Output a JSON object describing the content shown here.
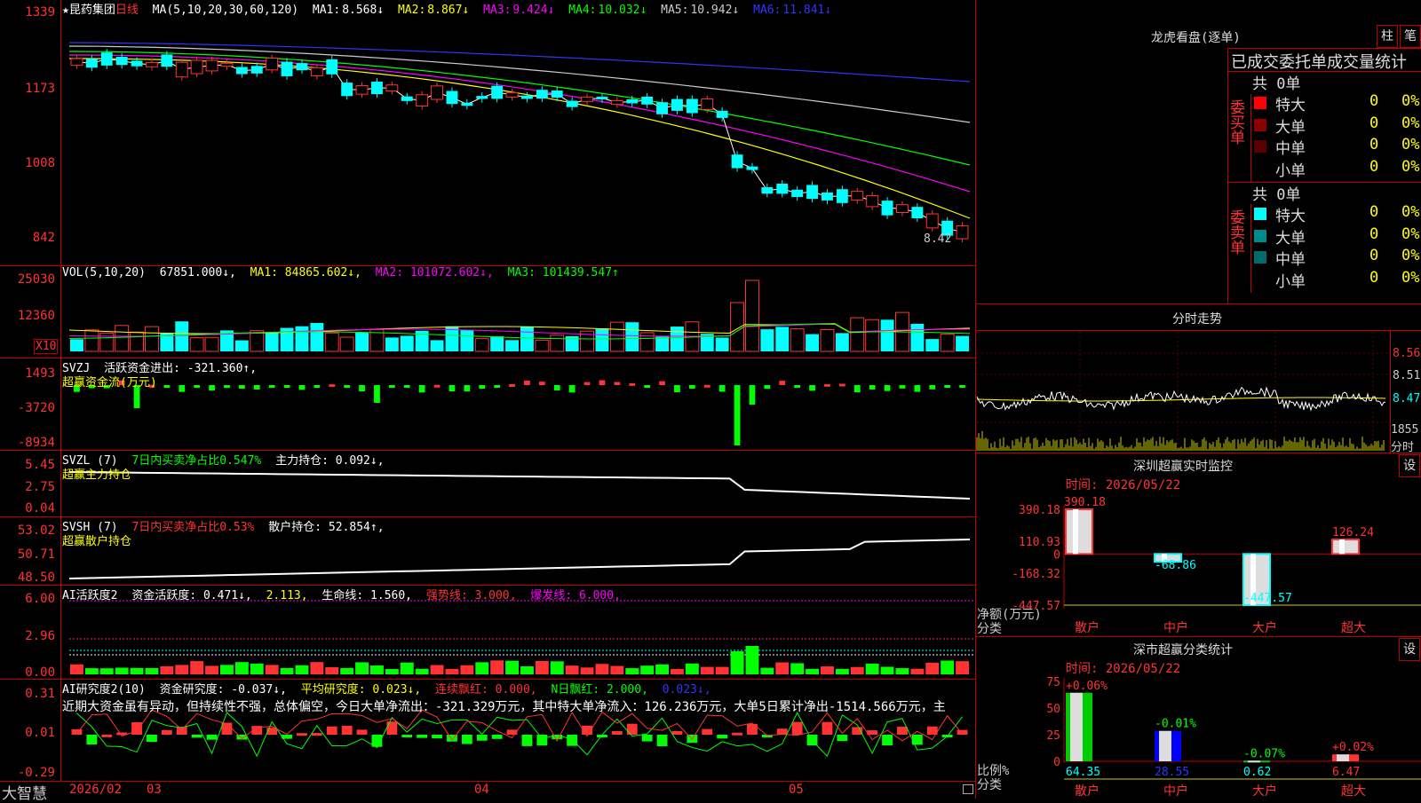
{
  "brand": "大智慧",
  "main": {
    "stock": "★昆药集团",
    "period": "日线",
    "ma_header": {
      "ma": "MA(5,10,20,30,60,120)",
      "items": [
        {
          "label": "MA1:",
          "value": "8.568↓",
          "color": "#ffffff"
        },
        {
          "label": "MA2:",
          "value": "8.867↓",
          "color": "#ffff00"
        },
        {
          "label": "MA3:",
          "value": "9.424↓",
          "color": "#ff00ff"
        },
        {
          "label": "MA4:",
          "value": "10.032↓",
          "color": "#00ff00"
        },
        {
          "label": "MA5:",
          "value": "10.942↓",
          "color": "#cccccc"
        },
        {
          "label": "MA6:",
          "value": "11.841↓",
          "color": "#3333ff"
        }
      ]
    },
    "yticks": [
      "1339",
      "1173",
      "1008",
      "842"
    ],
    "last_price": "8.42"
  },
  "vol": {
    "header": "VOL(5,10,20)",
    "value": "67851.000↓,",
    "ma1": "MA1: 84865.602↓,",
    "ma2": "MA2: 101072.602↓,",
    "ma3": "MA3: 101439.547↑",
    "yticks": [
      "25030",
      "12360"
    ],
    "unit": "X10"
  },
  "svzj": {
    "header": "SVZJ",
    "desc": "活跃资金进出: -321.360↑,",
    "sub": "超赢资金流(万元)",
    "yticks": [
      "1493",
      "-3720",
      "-8934"
    ]
  },
  "svzl": {
    "header": "SVZL (7)",
    "desc": "7日内买卖净占比0.547%",
    "desc2": "主力持仓: 0.092↓,",
    "sub": "超赢主力持仓",
    "yticks": [
      "5.45",
      "2.75",
      "0.04"
    ]
  },
  "svsh": {
    "header": "SVSH (7)",
    "desc": "7日内买卖净占比0.53%",
    "desc2": "散户持仓: 52.854↑,",
    "sub": "超赢散户持仓",
    "yticks": [
      "53.02",
      "50.71",
      "48.50"
    ]
  },
  "ai1": {
    "header": "AI活跃度2",
    "a": "资金活跃度: 0.471↓,",
    "b": "2.113,",
    "c": "生命线: 1.560,",
    "d": "强势线: 3.000,",
    "e": "爆发线: 6.000,",
    "yticks": [
      "6.00",
      "2.96",
      "0.00"
    ]
  },
  "ai2": {
    "header": "AI研究度2(10)",
    "a": "资金研究度: -0.037↓,",
    "b": "平均研究度: 0.023↓,",
    "c": "连续飘红: 0.000,",
    "d": "N日飘红: 2.000,",
    "e": "0.023↓,",
    "text": "近期大资金虽有异动，但持续性不强，总体偏空，今日大单净流出：-321.329万元，其中特大单净流入：126.236万元，大单5日累计净出-1514.566万元，主",
    "yticks": [
      "0.31",
      "0.01",
      "-0.29"
    ]
  },
  "xaxis": [
    "2026/02",
    "03",
    "04",
    "05"
  ],
  "dragon": {
    "title": "龙虎看盘(逐单)",
    "btn1": "柱",
    "btn2": "笔",
    "stat_title": "已成交委托单成交量统计",
    "buy_label": "委买单",
    "sell_label": "委卖单",
    "buy_total": "共 0单",
    "sell_total": "共 0单",
    "buy_rows": [
      {
        "label": "特大",
        "count": "0",
        "pct": "0%",
        "color": "#ff0000"
      },
      {
        "label": "大单",
        "count": "0",
        "pct": "0%",
        "color": "#8b0000"
      },
      {
        "label": "中单",
        "count": "0",
        "pct": "0%",
        "color": "#5a0000"
      },
      {
        "label": "小单",
        "count": "0",
        "pct": "0%",
        "color": "#000000"
      }
    ],
    "sell_rows": [
      {
        "label": "特大",
        "count": "0",
        "pct": "0%",
        "color": "#00ffff"
      },
      {
        "label": "大单",
        "count": "0",
        "pct": "0%",
        "color": "#008b8b"
      },
      {
        "label": "中单",
        "count": "0",
        "pct": "0%",
        "color": "#006b6b"
      },
      {
        "label": "小单",
        "count": "0",
        "pct": "0%",
        "color": "#000000"
      }
    ]
  },
  "intraday": {
    "title": "分时走势",
    "yticks": [
      "8.56",
      "8.51",
      "8.47"
    ],
    "vol_label": "1855",
    "vol_unit": "分时"
  },
  "monitor": {
    "title": "深圳超赢实时监控",
    "set": "设",
    "time": "时间: 2026/05/22",
    "yticks": [
      "390.18",
      "110.93",
      "0",
      "-168.32",
      "-447.57"
    ],
    "ylabel": "净额(万元)",
    "xlabel": "分类",
    "categories": [
      "散户",
      "中户",
      "大户",
      "超大"
    ],
    "values": [
      "390.18",
      "-68.86",
      "-447.57",
      "126.24"
    ]
  },
  "classify": {
    "title": "深市超赢分类统计",
    "set": "设",
    "time": "时间: 2026/05/22",
    "yticks": [
      "75",
      "50",
      "25",
      "0"
    ],
    "ylabel": "比例%",
    "xlabel": "分类",
    "categories": [
      "散户",
      "中户",
      "大户",
      "超大"
    ],
    "changes": [
      "+0.06%",
      "-0.01%",
      "-0.07%",
      "+0.02%"
    ],
    "values": [
      "64.35",
      "28.55",
      "0.62",
      "6.47"
    ]
  },
  "chart_data": [
    {
      "type": "bar",
      "title": "深圳超赢实时监控",
      "ylabel": "净额(万元)",
      "xlabel": "分类",
      "categories": [
        "散户",
        "中户",
        "大户",
        "超大"
      ],
      "values": [
        390.18,
        -68.86,
        -447.57,
        126.24
      ],
      "ylim": [
        -447.57,
        390.18
      ]
    },
    {
      "type": "bar",
      "title": "深市超赢分类统计",
      "ylabel": "比例%",
      "xlabel": "分类",
      "categories": [
        "散户",
        "中户",
        "大户",
        "超大"
      ],
      "values": [
        64.35,
        28.55,
        0.62,
        6.47
      ],
      "ylim": [
        0,
        75
      ]
    },
    {
      "type": "line",
      "title": "昆药集团 日线",
      "series": [
        {
          "name": "MA1",
          "values": [
            12.7,
            12.6,
            12.4,
            12.0,
            11.8,
            11.5,
            11.3,
            11.0,
            10.4,
            9.6,
            9.3,
            9.0,
            8.8,
            8.57
          ]
        },
        {
          "name": "MA6",
          "values": [
            13.1,
            13.0,
            12.95,
            12.9,
            12.85,
            12.8,
            12.75,
            12.7,
            12.6,
            12.5,
            12.35,
            12.2,
            12.0,
            11.84
          ]
        }
      ]
    }
  ]
}
